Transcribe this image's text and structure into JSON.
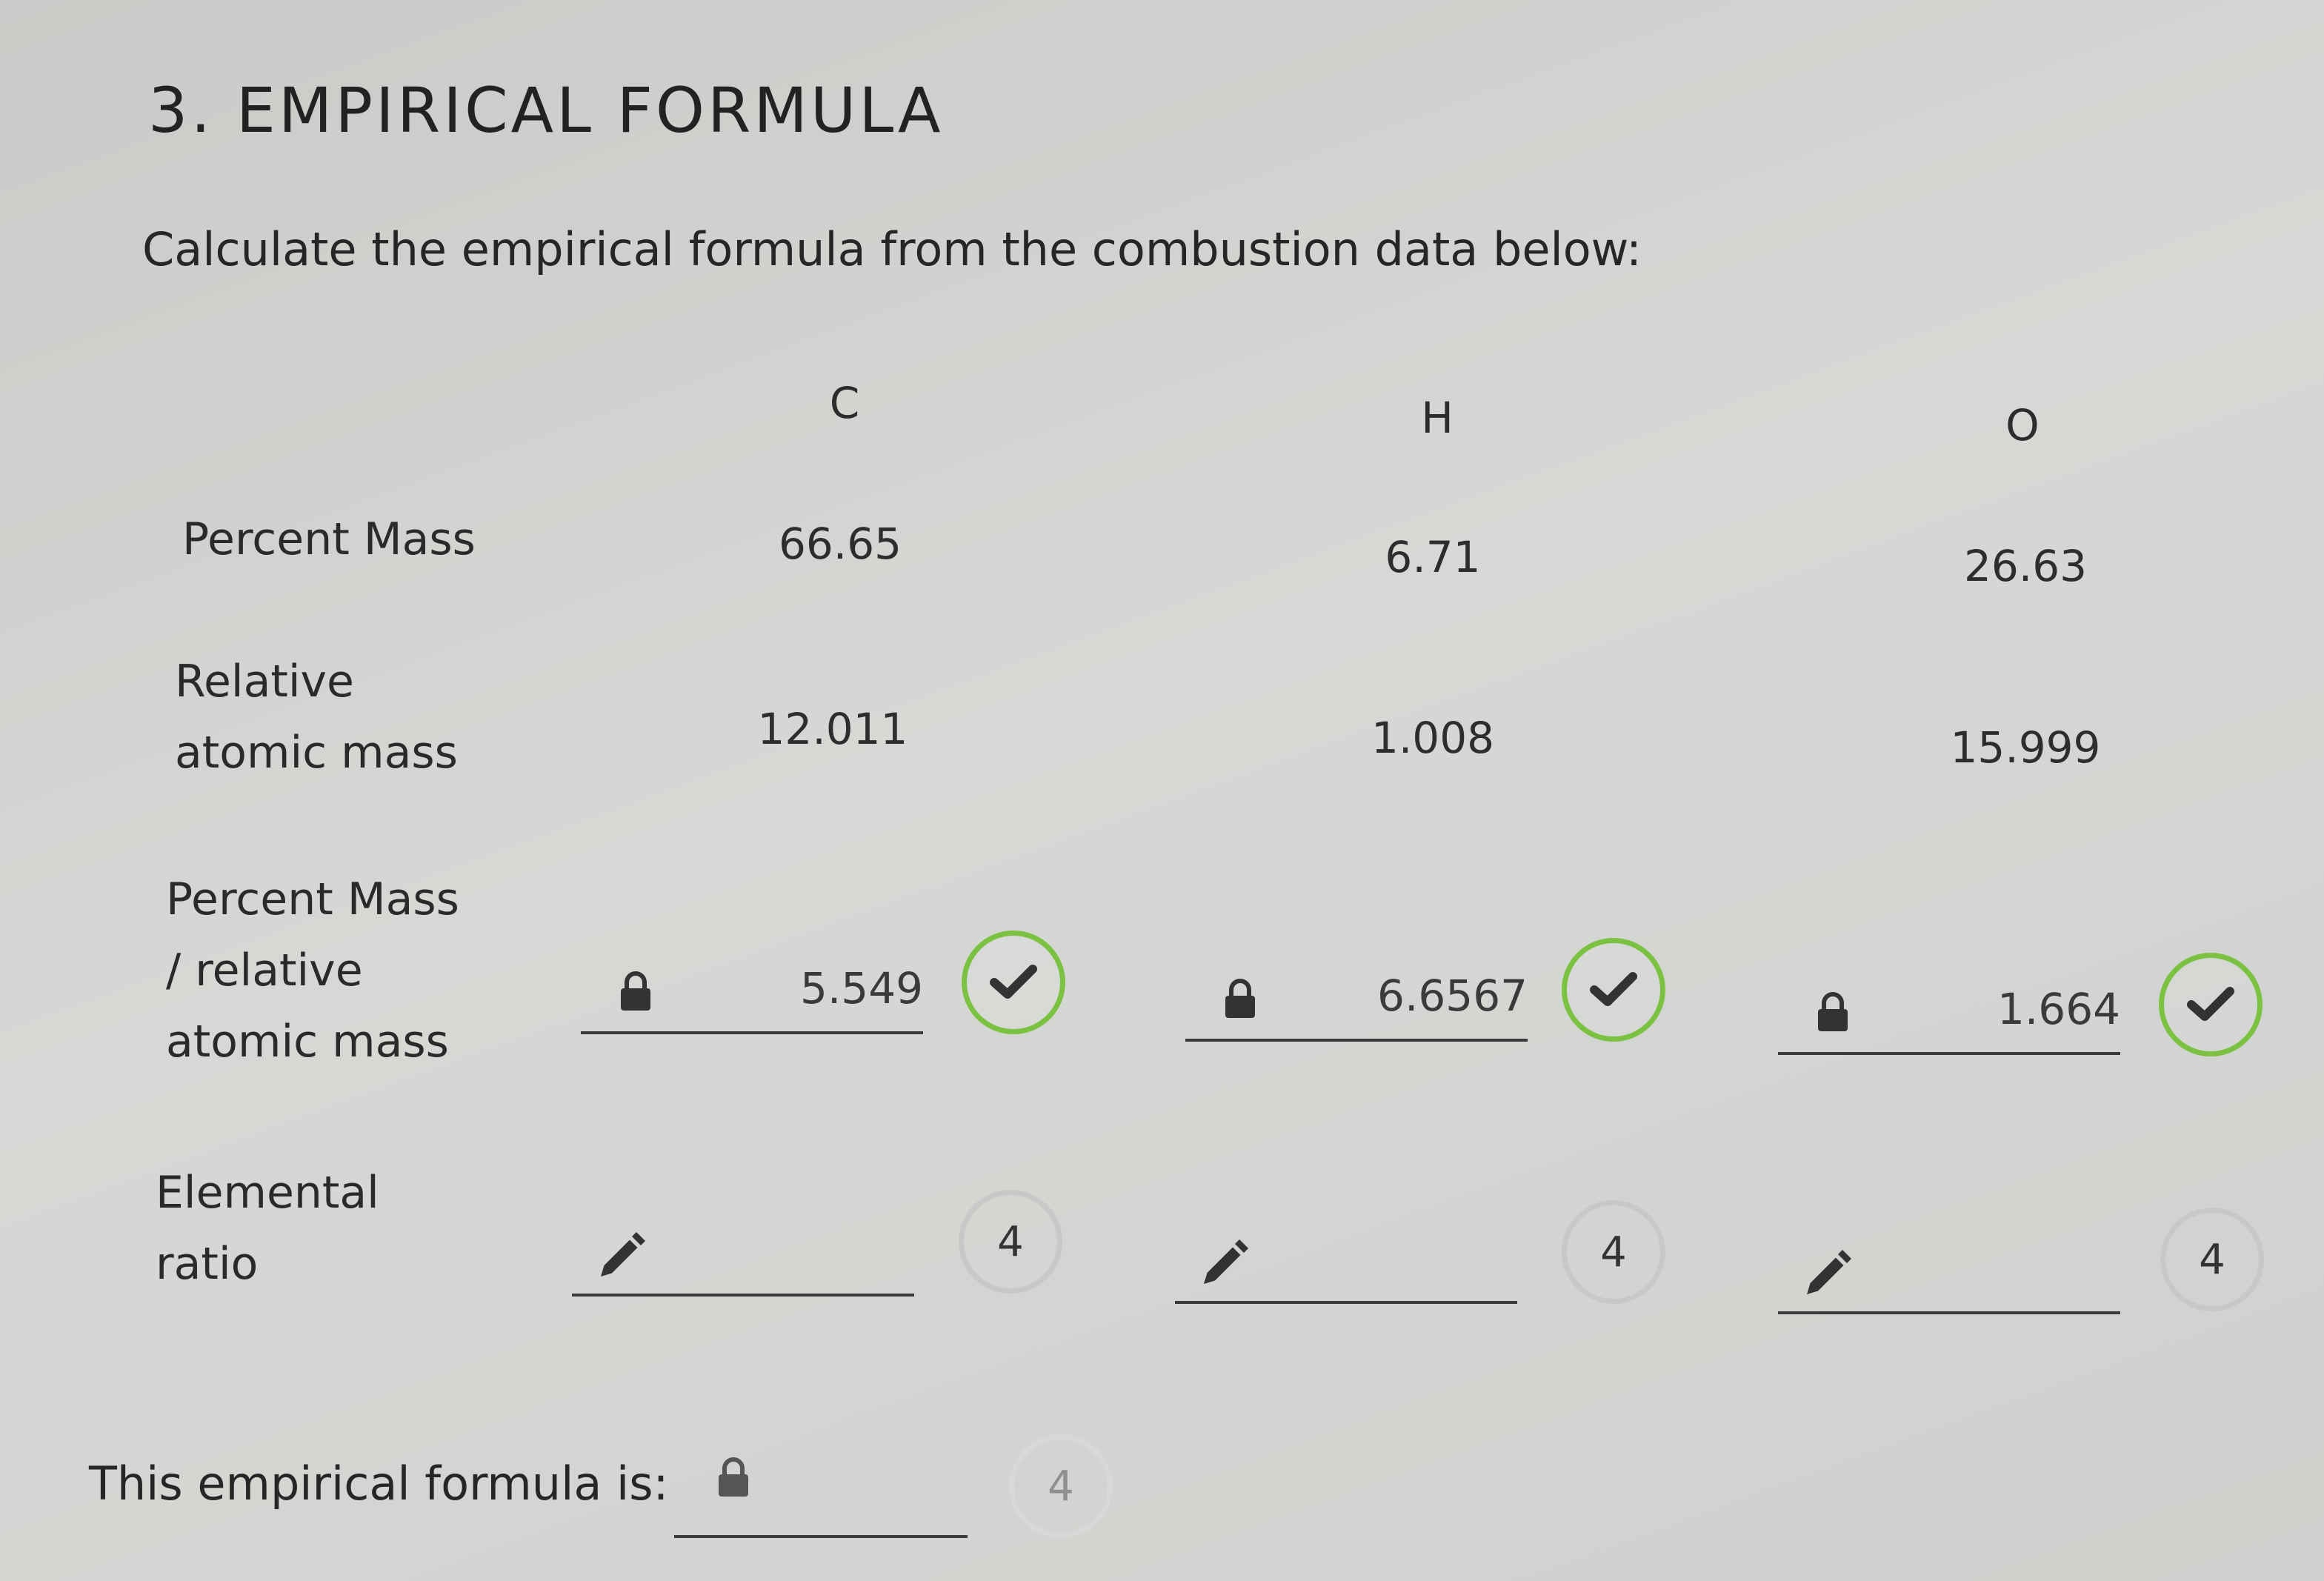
{
  "section_title": "3. EMPIRICAL FORMULA",
  "instructions": "Calculate the empirical formula from the combustion data below:",
  "columns": [
    "C",
    "H",
    "O"
  ],
  "rows": {
    "percent_mass": {
      "label": "Percent Mass",
      "values": [
        "66.65",
        "6.71",
        "26.63"
      ]
    },
    "relative_atomic_mass": {
      "label_line1": "Relative",
      "label_line2": "atomic mass",
      "values": [
        "12.011",
        "1.008",
        "15.999"
      ]
    },
    "percent_over_ram": {
      "label_line1": "Percent Mass",
      "label_line2": "/ relative",
      "label_line3": "atomic mass",
      "values": [
        "5.549",
        "6.6567",
        "1.664"
      ]
    },
    "elemental_ratio": {
      "label_line1": "Elemental",
      "label_line2": "ratio",
      "values": [
        "",
        "",
        ""
      ],
      "attempts": [
        "4",
        "4",
        "4"
      ]
    }
  },
  "formula": {
    "label": "This empirical formula is:",
    "value": "",
    "attempts": "4"
  },
  "icons": {
    "locked": "lock-icon",
    "editable": "pencil-icon",
    "correct": "check-icon"
  },
  "colors": {
    "correct": "#7cc242"
  }
}
